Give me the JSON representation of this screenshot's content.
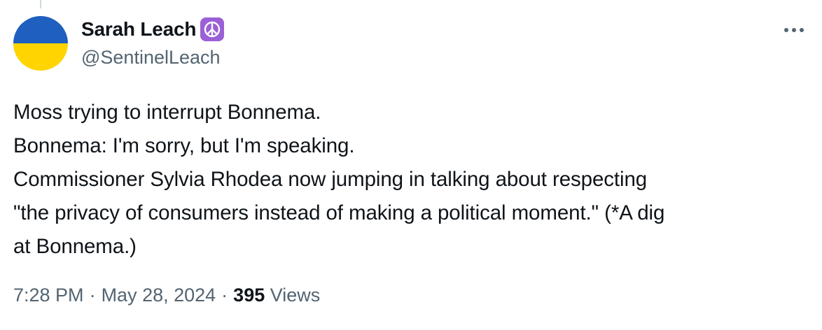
{
  "tweet": {
    "author": {
      "display_name": "Sarah Leach",
      "handle": "@SentinelLeach",
      "badge_icon": "peace-symbol-icon",
      "avatar_colors": [
        "#1f5fbf",
        "#ffd400"
      ]
    },
    "text_lines": [
      "Moss trying to interrupt Bonnema.",
      "Bonnema: I'm sorry, but I'm speaking.",
      "Commissioner Sylvia Rhodea now jumping in talking about respecting",
      "\"the privacy of consumers instead of making a political moment.\" (*A dig",
      "at Bonnema.)"
    ],
    "time": "7:28 PM",
    "date": "May 28, 2024",
    "separator": "·",
    "views_count": "395",
    "views_label": "Views"
  },
  "actions": {
    "more_icon": "more-horizontal-icon"
  },
  "colors": {
    "text_primary": "#0f1419",
    "text_secondary": "#536471",
    "badge_bg": "#9b5fd6"
  }
}
